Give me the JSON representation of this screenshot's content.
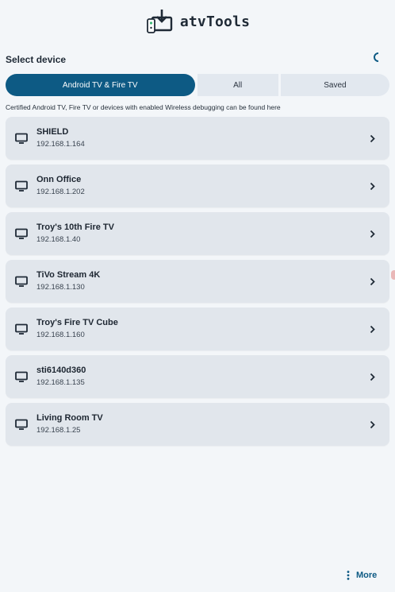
{
  "app": {
    "title": "atvTools"
  },
  "section": {
    "title": "Select device"
  },
  "tabs": [
    {
      "label": "Android TV & Fire TV",
      "active": true
    },
    {
      "label": "All",
      "active": false
    },
    {
      "label": "Saved",
      "active": false
    }
  ],
  "helper_text": "Certified Android TV, Fire TV or devices with enabled Wireless debugging can be found here",
  "devices": [
    {
      "name": "SHIELD",
      "ip": "192.168.1.164"
    },
    {
      "name": "Onn Office",
      "ip": "192.168.1.202"
    },
    {
      "name": "Troy's 10th Fire TV",
      "ip": "192.168.1.40"
    },
    {
      "name": "TiVo Stream 4K",
      "ip": "192.168.1.130"
    },
    {
      "name": "Troy's Fire TV Cube",
      "ip": "192.168.1.160"
    },
    {
      "name": "sti6140d360",
      "ip": "192.168.1.135"
    },
    {
      "name": "Living Room TV",
      "ip": "192.168.1.25"
    }
  ],
  "footer": {
    "more_label": "More"
  },
  "icons": {
    "logo": "download-tv-logo-icon",
    "device": "tv-icon",
    "row_action": "chevron-right-icon",
    "more": "more-vertical-icon",
    "loading": "spinner-icon"
  },
  "colors": {
    "accent": "#0d5a84",
    "background": "#f3f6f9",
    "card": "#e1e6ec"
  }
}
